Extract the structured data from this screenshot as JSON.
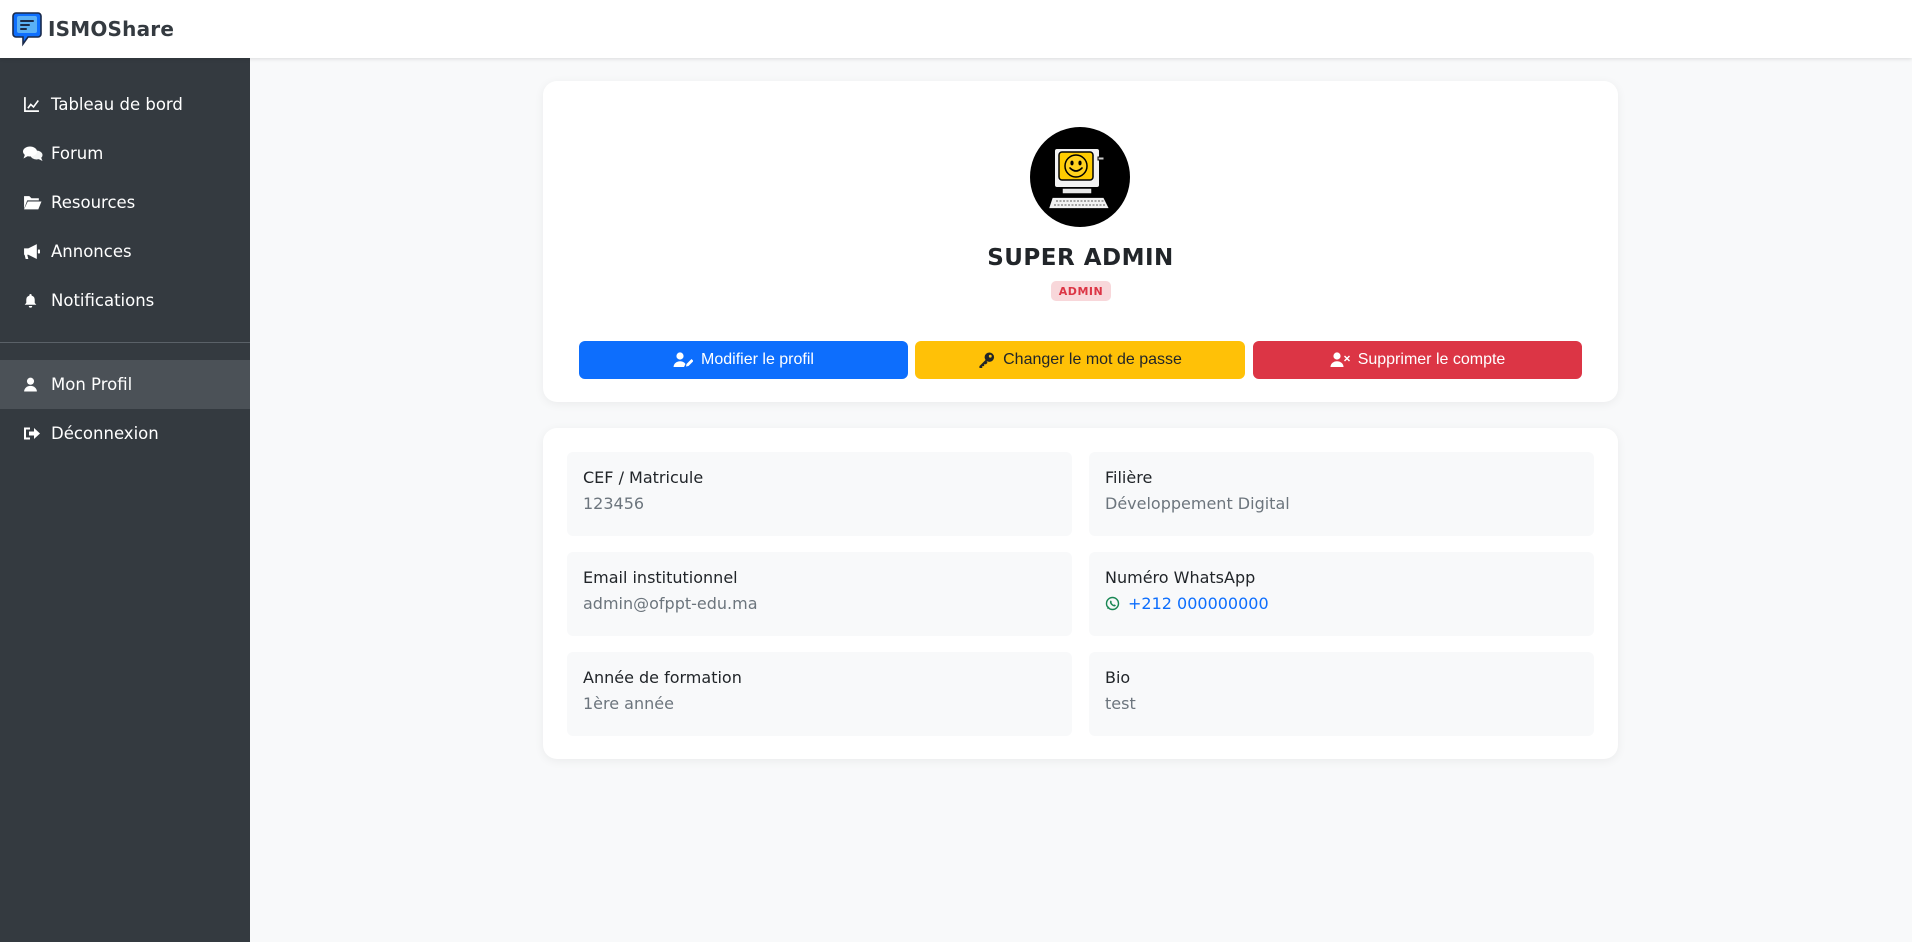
{
  "app": {
    "brand": "ISMOShare"
  },
  "sidebar": {
    "items": [
      {
        "label": "Tableau de bord",
        "icon": "chart-line-icon"
      },
      {
        "label": "Forum",
        "icon": "comments-icon"
      },
      {
        "label": "Resources",
        "icon": "folder-open-icon"
      },
      {
        "label": "Annonces",
        "icon": "bullhorn-icon"
      },
      {
        "label": "Notifications",
        "icon": "bell-icon"
      }
    ],
    "secondary": [
      {
        "label": "Mon Profil",
        "icon": "user-icon",
        "active": true
      },
      {
        "label": "Déconnexion",
        "icon": "sign-out-icon"
      }
    ]
  },
  "profile": {
    "name": "SUPER ADMIN",
    "role": "ADMIN",
    "avatar": "computer-smiley-avatar",
    "buttons": {
      "edit": "Modifier le profil",
      "password": "Changer le mot de passe",
      "delete": "Supprimer le compte"
    }
  },
  "info": {
    "cef": {
      "label": "CEF / Matricule",
      "value": "123456"
    },
    "filiere": {
      "label": "Filière",
      "value": "Développement Digital"
    },
    "email": {
      "label": "Email institutionnel",
      "value": "admin@ofppt-edu.ma"
    },
    "whatsapp": {
      "label": "Numéro WhatsApp",
      "value": "+212 000000000"
    },
    "annee": {
      "label": "Année de formation",
      "value": "1ère année"
    },
    "bio": {
      "label": "Bio",
      "value": "test"
    }
  },
  "colors": {
    "primary": "#0d6efd",
    "warning": "#ffc107",
    "danger": "#dc3545",
    "sidebar": "#343a40",
    "whatsapp": "#25d366"
  }
}
